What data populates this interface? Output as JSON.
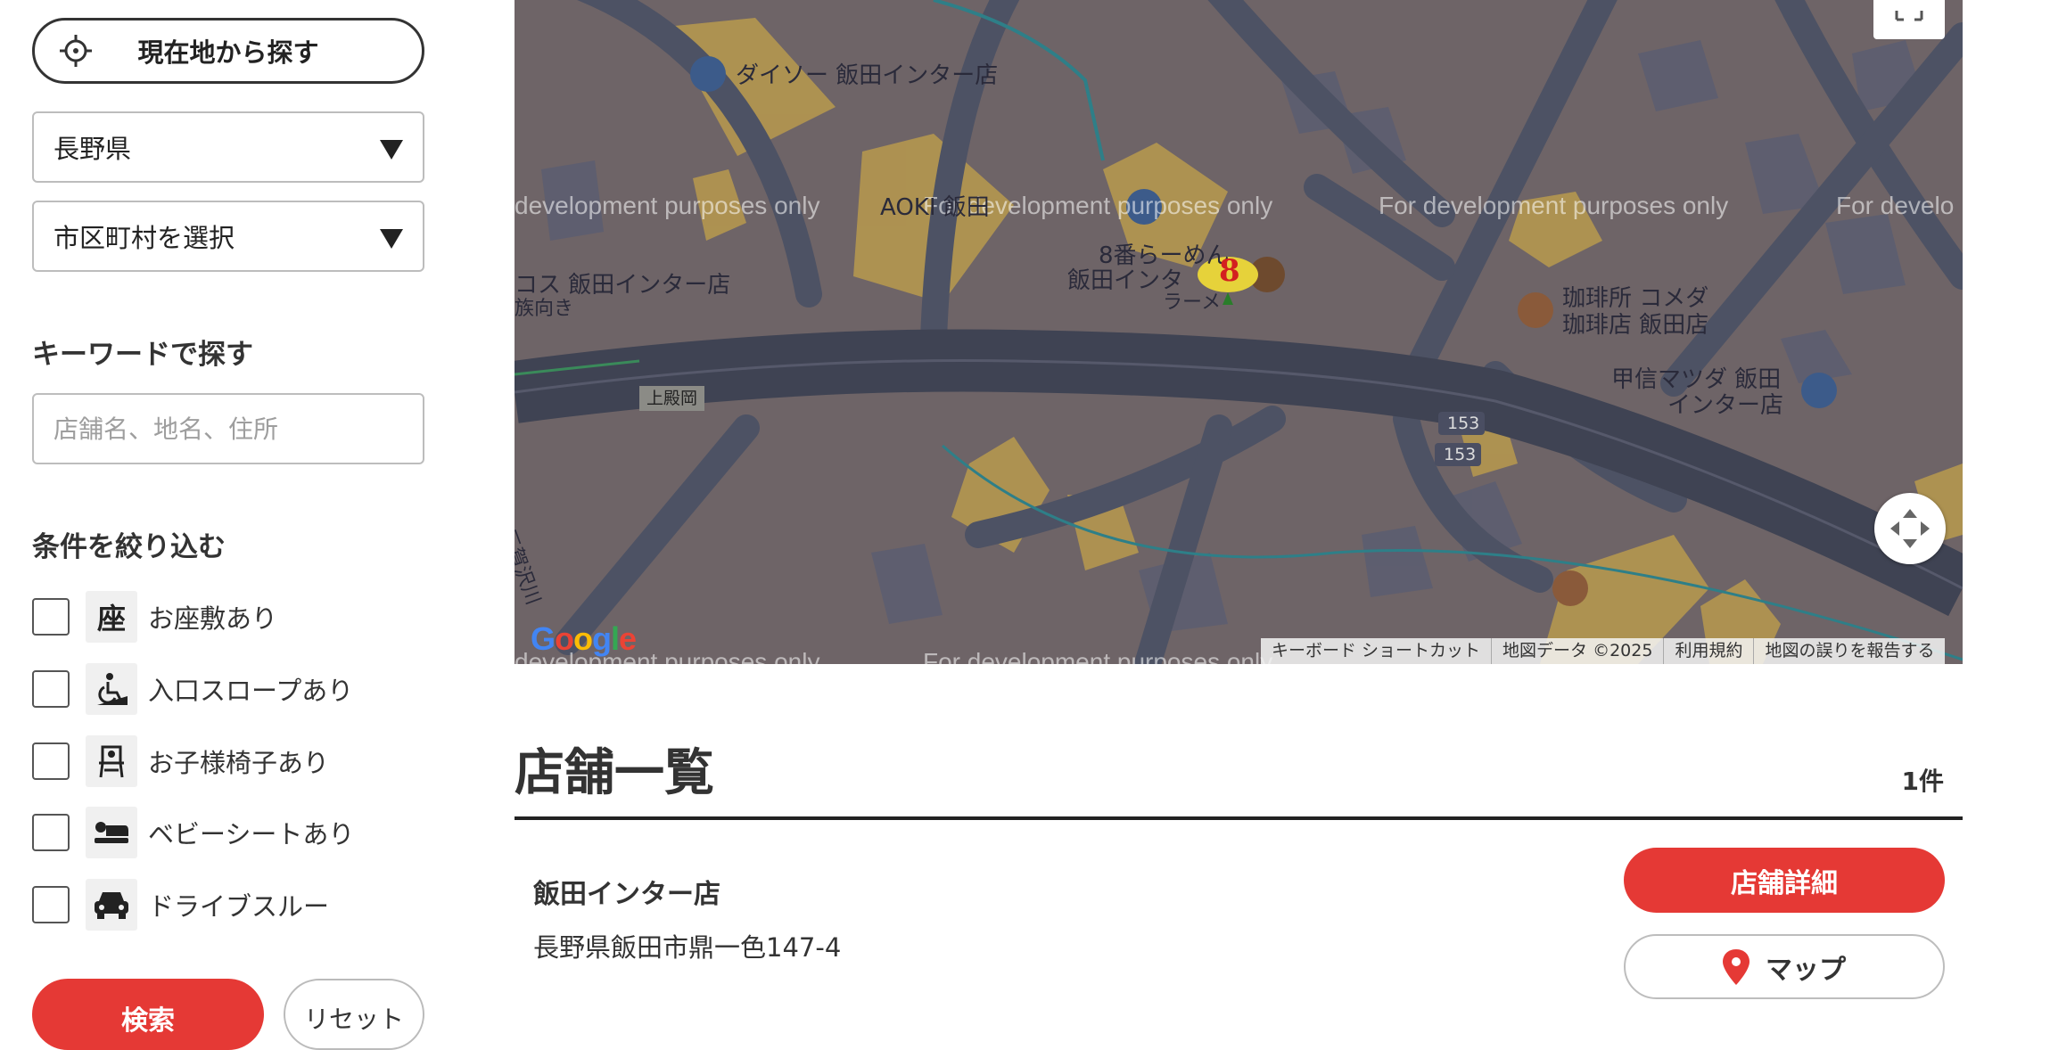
{
  "sidebar": {
    "location_button": "現在地から探す",
    "prefecture_select": "長野県",
    "city_select": "市区町村を選択",
    "keyword_title": "キーワードで探す",
    "keyword_placeholder": "店舗名、地名、住所",
    "keyword_value": "",
    "conditions_title": "条件を絞り込む",
    "conditions": [
      {
        "label": "お座敷あり",
        "icon": "zashiki-icon",
        "icon_text": "座",
        "checked": false
      },
      {
        "label": "入口スロープあり",
        "icon": "wheelchair-icon",
        "checked": false
      },
      {
        "label": "お子様椅子あり",
        "icon": "child-chair-icon",
        "checked": false
      },
      {
        "label": "ベビーシートあり",
        "icon": "baby-seat-icon",
        "checked": false
      },
      {
        "label": "ドライブスルー",
        "icon": "car-icon",
        "checked": false
      }
    ],
    "search_button": "検索",
    "reset_button": "リセット"
  },
  "map": {
    "watermark": "For development purposes only",
    "watermark_left_crop": "development purposes only",
    "watermark_right_crop": "For develo",
    "pois": {
      "daiso": "ダイソー 飯田インター店",
      "aoki": "AOKI 飯田",
      "ramen_1": "8番らーめん",
      "ramen_2": "飯田インタ",
      "ramen_3": "ラーメ",
      "costco": "コス 飯田インター店",
      "costco_sub": "族向き",
      "komeda_1": "珈琲所 コメダ",
      "komeda_2": "珈琲店 飯田店",
      "mazda_1": "甲信マツダ 飯田",
      "mazda_2": "インター店",
      "river": "三賀沢川",
      "stop": "上殿岡",
      "route_1": "153",
      "route_2": "153"
    },
    "marker_text": "8",
    "google": [
      "G",
      "o",
      "o",
      "g",
      "l",
      "e"
    ],
    "attribution": {
      "shortcuts": "キーボード ショートカット",
      "data": "地図データ ©2025",
      "terms": "利用規約",
      "report": "地図の誤りを報告する"
    }
  },
  "list": {
    "title": "店舗一覧",
    "count": "1件",
    "stores": [
      {
        "name": "飯田インター店",
        "address": "長野県飯田市鼎一色147-4",
        "detail_button": "店舗詳細",
        "map_button": "マップ"
      }
    ]
  },
  "colors": {
    "accent": "#e53935",
    "map_bg": "#6e6467",
    "building": "#b89a4e"
  }
}
